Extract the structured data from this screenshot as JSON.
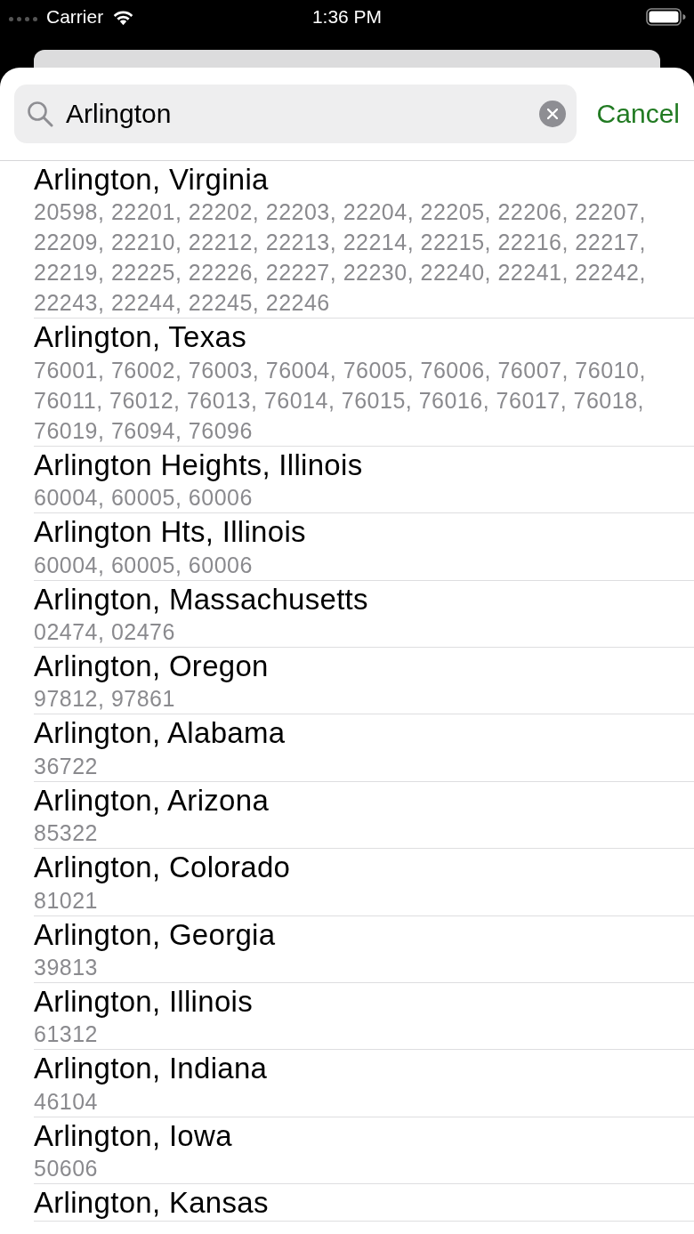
{
  "status_bar": {
    "carrier": "Carrier",
    "time": "1:36 PM"
  },
  "search": {
    "value": "Arlington",
    "cancel": "Cancel"
  },
  "results": [
    {
      "title": "Arlington, Virginia",
      "zips": "20598, 22201, 22202, 22203, 22204, 22205, 22206, 22207, 22209, 22210, 22212, 22213, 22214, 22215, 22216, 22217, 22219, 22225, 22226, 22227, 22230, 22240, 22241, 22242, 22243, 22244, 22245, 22246"
    },
    {
      "title": "Arlington, Texas",
      "zips": "76001, 76002, 76003, 76004, 76005, 76006, 76007, 76010, 76011, 76012, 76013, 76014, 76015, 76016, 76017, 76018, 76019, 76094, 76096"
    },
    {
      "title": "Arlington Heights, Illinois",
      "zips": "60004, 60005, 60006"
    },
    {
      "title": "Arlington Hts, Illinois",
      "zips": "60004, 60005, 60006"
    },
    {
      "title": "Arlington, Massachusetts",
      "zips": "02474, 02476"
    },
    {
      "title": "Arlington, Oregon",
      "zips": "97812, 97861"
    },
    {
      "title": "Arlington, Alabama",
      "zips": "36722"
    },
    {
      "title": "Arlington, Arizona",
      "zips": "85322"
    },
    {
      "title": "Arlington, Colorado",
      "zips": "81021"
    },
    {
      "title": "Arlington, Georgia",
      "zips": "39813"
    },
    {
      "title": "Arlington, Illinois",
      "zips": "61312"
    },
    {
      "title": "Arlington, Indiana",
      "zips": "46104"
    },
    {
      "title": "Arlington, Iowa",
      "zips": "50606"
    },
    {
      "title": "Arlington, Kansas"
    }
  ]
}
